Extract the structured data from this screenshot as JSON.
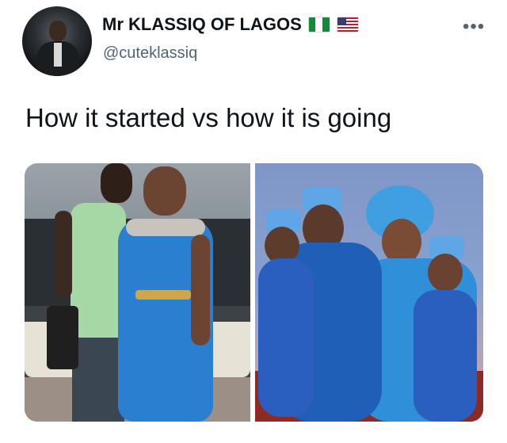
{
  "tweet": {
    "display_name": "Mr KLASSIQ OF LAGOS",
    "handle": "@cuteklassiq",
    "text": "How it started vs how it is going",
    "more_label": "•••"
  },
  "author_badges": [
    {
      "icon": "nigeria-flag-icon",
      "colors": [
        "#118a3c",
        "#ffffff",
        "#118a3c"
      ]
    },
    {
      "icon": "usa-flag-icon"
    }
  ],
  "media": [
    {
      "caption": "",
      "icon": "photo-how-it-started"
    },
    {
      "caption": "",
      "icon": "photo-how-it-is-going"
    }
  ]
}
